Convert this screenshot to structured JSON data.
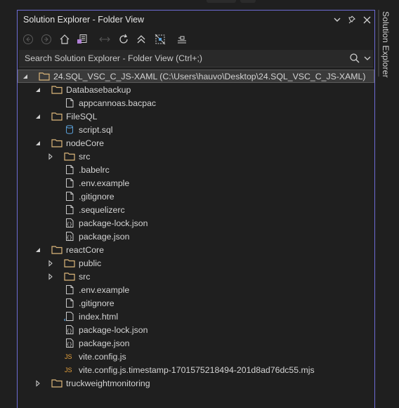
{
  "window": {
    "title": "Solution Explorer - Folder View",
    "side_tab_label": "Solution Explorer"
  },
  "toolbar": {
    "buttons": [
      "back-icon",
      "forward-icon",
      "home-icon",
      "switch-views-icon",
      "sync-icon",
      "refresh-icon",
      "collapse-all-icon",
      "show-all-files-icon",
      "properties-icon"
    ]
  },
  "search": {
    "placeholder": "Search Solution Explorer - Folder View (Ctrl+;)"
  },
  "colors": {
    "accent_border": "#6d6cd4",
    "folder": "#dcb67a",
    "js_icon": "#e8a33d",
    "db_icon": "#5aa0d8",
    "selected_row": "#3a3a3a"
  },
  "tree": [
    {
      "label": "24.SQL_VSC_C_JS-XAML (C:\\Users\\hauvo\\Desktop\\24.SQL_VSC_C_JS-XAML)",
      "depth": 0,
      "type": "folder",
      "state": "expanded",
      "selected": true
    },
    {
      "label": "Databasebackup",
      "depth": 1,
      "type": "folder",
      "state": "expanded"
    },
    {
      "label": "appcannoas.bacpac",
      "depth": 2,
      "type": "file"
    },
    {
      "label": "FileSQL",
      "depth": 1,
      "type": "folder",
      "state": "expanded"
    },
    {
      "label": "script.sql",
      "depth": 2,
      "type": "sql"
    },
    {
      "label": "nodeCore",
      "depth": 1,
      "type": "folder",
      "state": "expanded"
    },
    {
      "label": "src",
      "depth": 2,
      "type": "folder",
      "state": "collapsed"
    },
    {
      "label": ".babelrc",
      "depth": 2,
      "type": "file"
    },
    {
      "label": ".env.example",
      "depth": 2,
      "type": "file"
    },
    {
      "label": ".gitignore",
      "depth": 2,
      "type": "file"
    },
    {
      "label": ".sequelizerc",
      "depth": 2,
      "type": "file"
    },
    {
      "label": "package-lock.json",
      "depth": 2,
      "type": "json"
    },
    {
      "label": "package.json",
      "depth": 2,
      "type": "json"
    },
    {
      "label": "reactCore",
      "depth": 1,
      "type": "folder",
      "state": "expanded"
    },
    {
      "label": "public",
      "depth": 2,
      "type": "folder",
      "state": "collapsed"
    },
    {
      "label": "src",
      "depth": 2,
      "type": "folder",
      "state": "collapsed"
    },
    {
      "label": ".env.example",
      "depth": 2,
      "type": "file"
    },
    {
      "label": ".gitignore",
      "depth": 2,
      "type": "file"
    },
    {
      "label": "index.html",
      "depth": 2,
      "type": "html"
    },
    {
      "label": "package-lock.json",
      "depth": 2,
      "type": "json"
    },
    {
      "label": "package.json",
      "depth": 2,
      "type": "json"
    },
    {
      "label": "vite.config.js",
      "depth": 2,
      "type": "js"
    },
    {
      "label": "vite.config.js.timestamp-1701575218494-201d8ad76dc55.mjs",
      "depth": 2,
      "type": "js"
    },
    {
      "label": "truckweightmonitoring",
      "depth": 1,
      "type": "folder",
      "state": "collapsed"
    }
  ]
}
